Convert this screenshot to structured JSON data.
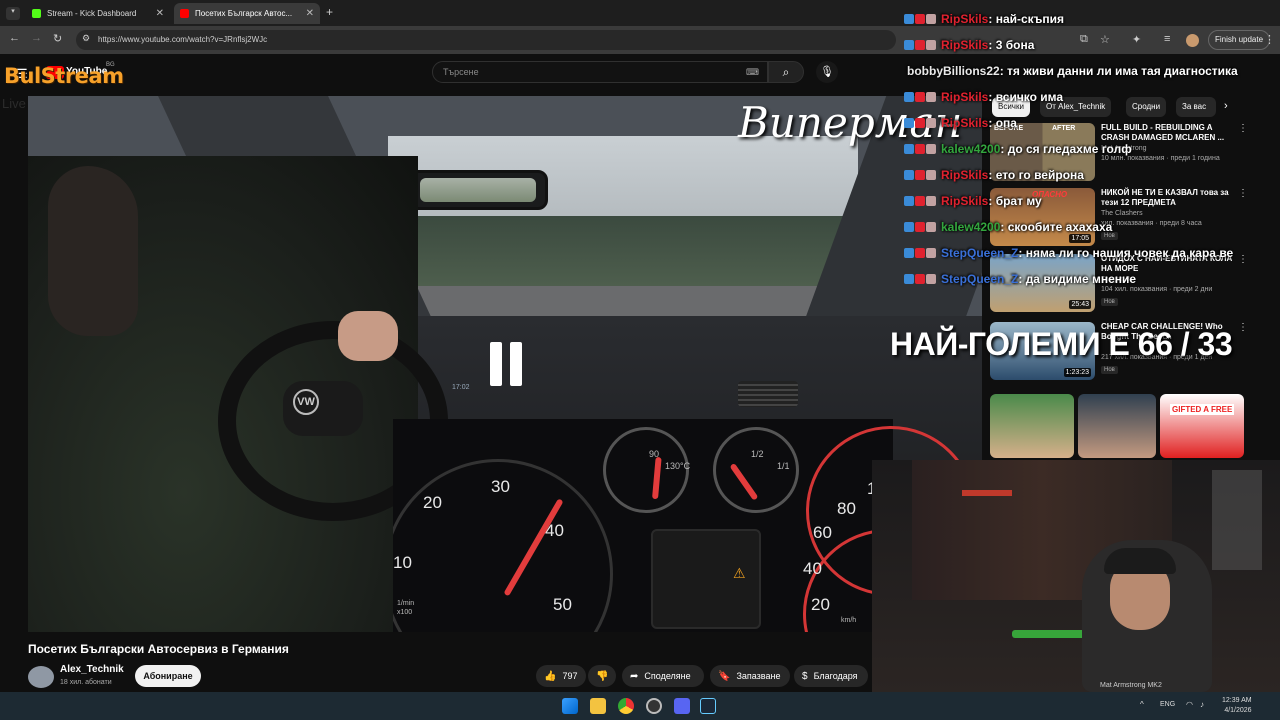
{
  "browser": {
    "tabs": [
      {
        "label": "Stream - Kick Dashboard",
        "active": false
      },
      {
        "label": "Посетих Българск Автос...",
        "active": true
      }
    ],
    "url": "https://www.youtube.com/watch?v=JRnflsj2WJc",
    "finish_update": "Finish update"
  },
  "overlay": {
    "logo": "BulStream",
    "logo_sub": "Live Webcasting Services",
    "yt_wordmark": "YouTube",
    "yt_country": "BG",
    "viperman": "Виперман",
    "counter": "НАЙ-ГОЛЕМИ Е 66 / 33"
  },
  "search": {
    "placeholder": "Търсене"
  },
  "video": {
    "title": "Посетих Български Автосервиз в Германия",
    "channel": "Alex_Technik",
    "subscribers": "18 хил. абонати",
    "subscribe": "Абониране",
    "likes": "797",
    "share": "Споделяне",
    "save": "Запазване",
    "thanks": "Благодаря",
    "gauges": {
      "speed_labels": [
        "20",
        "30",
        "40",
        "50",
        "10"
      ],
      "rpm_unit": "1/min x100",
      "temp": "130°C",
      "temp_low": "90",
      "fuel_half": "1/2",
      "fuel_full": "1/1",
      "speed_right": [
        "100",
        "80",
        "60",
        "40",
        "20"
      ],
      "kmh": "km/h",
      "clock": "17:02"
    }
  },
  "chips": [
    "Всички",
    "От Alex_Technik",
    "Сродни",
    "За вас"
  ],
  "recommendations": [
    {
      "title": "FULL BUILD - REBUILDING A CRASH DAMAGED MCLAREN ...",
      "channel": "Mat Armstrong",
      "views": "10 млн. показвания · преди 1 година",
      "duration": "",
      "badge": "",
      "thumb_a": "BEFORE",
      "thumb_b": "AFTER"
    },
    {
      "title": "НИКОЙ НЕ ТИ Е КАЗВАЛ това за тези 12 ПРЕДМЕТА",
      "channel": "The Clashers",
      "views": "хил. показвания · преди 8 часа",
      "duration": "17:05",
      "badge": "Нов",
      "thumb_a": "ОПАСНО"
    },
    {
      "title": "ОТИДОХ С НАЙ-ЕВТИНАТА КОЛА НА МОРЕ",
      "channel": "Dragos Bu",
      "views": "104 хил. показвания · преди 2 дни",
      "duration": "25:43",
      "badge": "Нов"
    },
    {
      "title": "CHEAP CAR CHALLENGE! Who Bought The Best...",
      "channel": "",
      "views": "217 хил. показвания · преди 1 ден",
      "duration": "1:23:23",
      "badge": "Нов"
    }
  ],
  "bottom_thumb_text": "GIFTED A FREE",
  "chat": [
    {
      "user": "RipSkils",
      "msg": ": най-скъпия",
      "color": "red",
      "badges": true
    },
    {
      "user": "RipSkils",
      "msg": ": 3 бона",
      "color": "red",
      "badges": true
    },
    {
      "user": "bobbyBillions22",
      "msg": ": тя живи данни ли има тая диагностика",
      "color": "white",
      "badges": false
    },
    {
      "user": "RipSkils",
      "msg": ": всичко има",
      "color": "red",
      "badges": true
    },
    {
      "user": "RipSkils",
      "msg": ": опа",
      "color": "red",
      "badges": true
    },
    {
      "user": "kalew4200",
      "msg": ": до ся гледахме голф",
      "color": "green",
      "badges": true
    },
    {
      "user": "RipSkils",
      "msg": ": ето го вейрона",
      "color": "red",
      "badges": true
    },
    {
      "user": "RipSkils",
      "msg": ": брат му",
      "color": "red",
      "badges": true
    },
    {
      "user": "kalew4200",
      "msg": ": скообите ахахаха",
      "color": "green",
      "badges": true
    },
    {
      "user": "StepQueen_Z",
      "msg": ": няма ли го нашия човек да кара ве",
      "color": "blue",
      "badges": true
    },
    {
      "user": "StepQueen_Z",
      "msg": ": да видиме мнение",
      "color": "blue",
      "badges": true
    }
  ],
  "webcam_label": "Mat Armstrong MK2",
  "tray": {
    "lang": "ENG",
    "time": "12:39 AM",
    "date": "4/1/2026"
  },
  "colors": {
    "accent_orange": "#f7a12a",
    "kick_green": "#53fc18",
    "yt_red": "#ff0000"
  }
}
